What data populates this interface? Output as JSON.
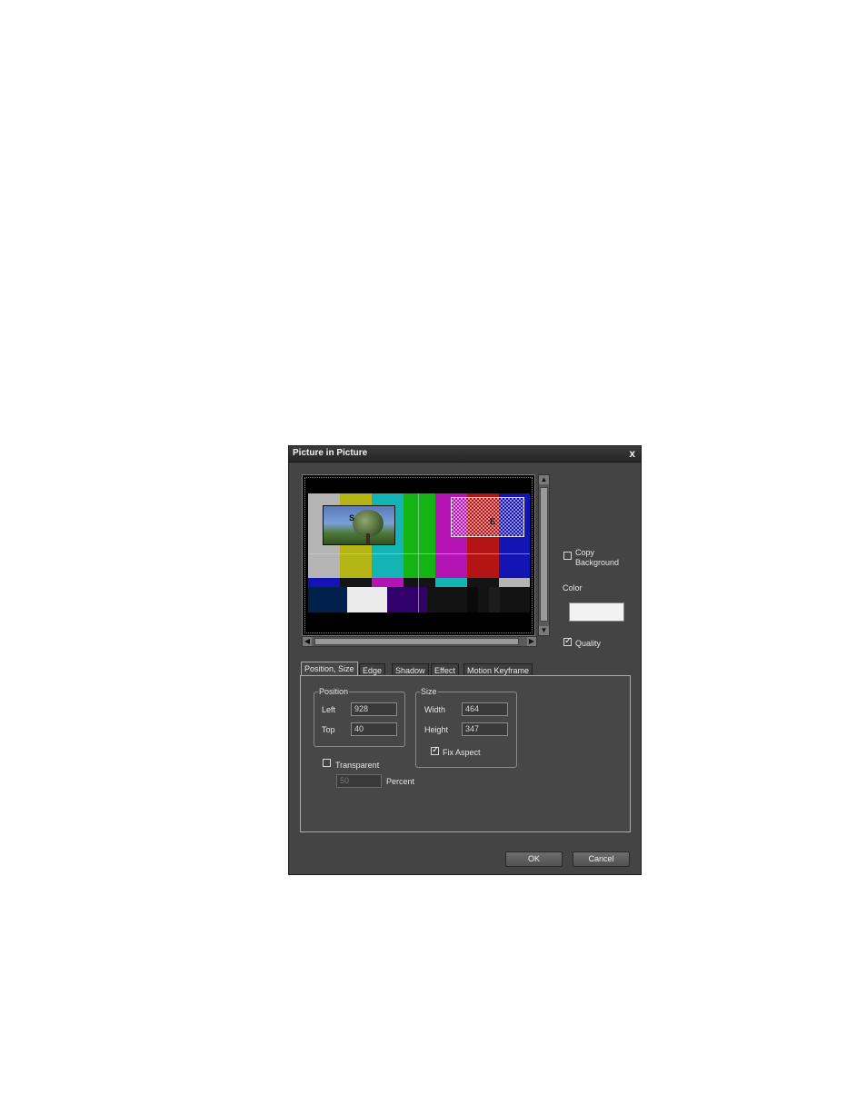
{
  "dialog": {
    "title": "Picture in Picture",
    "close_glyph": "x"
  },
  "preview": {
    "start_marker": "S",
    "end_marker": "E",
    "colors": {
      "gray": "#b4b4b4",
      "yellow": "#b4b414",
      "cyan": "#14b4b4",
      "green": "#14b414",
      "magenta": "#b414b4",
      "red": "#b41414",
      "blue": "#1414b4"
    }
  },
  "options": {
    "copy_background_label": "Copy\nBackground",
    "copy_background_line1": "Copy",
    "copy_background_line2": "Background",
    "copy_background_checked": false,
    "color_label": "Color",
    "color_value": "#f2f2f2",
    "quality_label": "Quality",
    "quality_checked": true
  },
  "tabs": [
    "Position, Size",
    "Edge",
    "Shadow",
    "Effect",
    "Motion Keyframe"
  ],
  "active_tab": "Position, Size",
  "position": {
    "group_title": "Position",
    "left_label": "Left",
    "left_value": "928",
    "top_label": "Top",
    "top_value": "40"
  },
  "size": {
    "group_title": "Size",
    "width_label": "Width",
    "width_value": "464",
    "height_label": "Height",
    "height_value": "347",
    "fix_aspect_label": "Fix Aspect",
    "fix_aspect_checked": true
  },
  "transparent": {
    "label": "Transparent",
    "checked": false,
    "value": "50",
    "unit_label": "Percent"
  },
  "buttons": {
    "ok": "OK",
    "cancel": "Cancel"
  }
}
